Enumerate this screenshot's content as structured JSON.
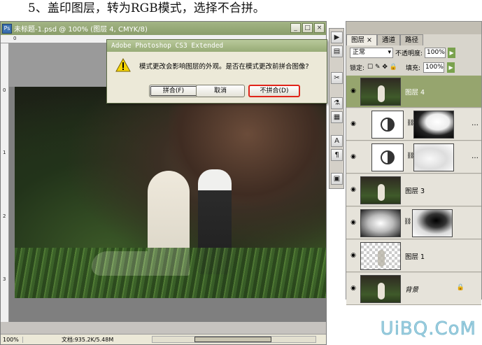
{
  "caption": "5、盖印图层，转为RGB模式，选择不合拼。",
  "document": {
    "title": "未标题-1.psd @ 100% (图层 4, CMYK/8)",
    "window_buttons": [
      "_",
      "□",
      "×"
    ],
    "ruler_h_labels": [
      "0"
    ],
    "ruler_v_labels": [
      "0",
      "1",
      "2",
      "3"
    ],
    "status_zoom": "100%",
    "status_docsize": "文档:935.2K/5.48M"
  },
  "dialog": {
    "title": "Adobe Photoshop CS3 Extended",
    "message": "模式更改会影响图层的外观。是否在模式更改前拼合图像?",
    "buttons": {
      "merge": "拼合(F)",
      "cancel": "取消",
      "dont_merge": "不拼合(D)"
    },
    "highlight_color": "#e0241a"
  },
  "tools": [
    "▶",
    "▤",
    "✂",
    "⚗",
    "▦",
    "A",
    "¶",
    "▣"
  ],
  "layers_panel": {
    "tabs": [
      "图层 ×",
      "通道",
      "路径"
    ],
    "blend_mode": "正常",
    "opacity_label": "不透明度:",
    "opacity_value": "100%",
    "lock_label": "锁定:",
    "lock_glyphs": "☐ ✎ ✥ 🔒",
    "fill_label": "填充:",
    "fill_value": "100%",
    "accent": "#96a56e",
    "layers": [
      {
        "name": "图层 4",
        "kind": "photo",
        "selected": true
      },
      {
        "name": "",
        "kind": "adjustment",
        "mask": "mask1"
      },
      {
        "name": "",
        "kind": "adjustment",
        "mask": "mask2"
      },
      {
        "name": "图层 3",
        "kind": "photo"
      },
      {
        "name": "",
        "kind": "gradient",
        "mask": "mask3"
      },
      {
        "name": "图层 1",
        "kind": "transparent"
      },
      {
        "name": "背景",
        "kind": "photo",
        "locked": true
      }
    ]
  },
  "watermark": "UiBQ.CoM"
}
